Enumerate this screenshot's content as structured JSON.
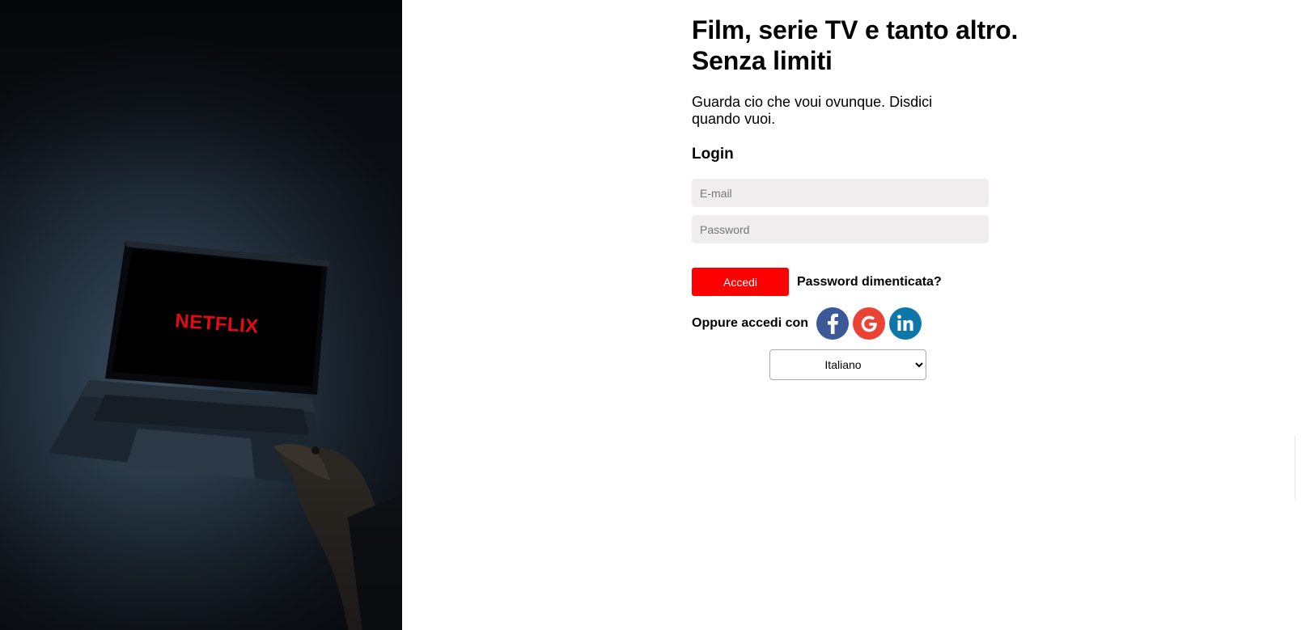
{
  "hero": {
    "brand_text": "NETFLIX"
  },
  "main": {
    "headline_line1": "Film, serie TV e tanto altro.",
    "headline_line2": "Senza limiti",
    "subtitle": "Guarda cio che voui ovunque. Disdici quando vuoi.",
    "login_heading": "Login",
    "email_placeholder": "E-mail",
    "password_placeholder": "Password",
    "login_button": "Accedi",
    "forgot_password": "Password dimenticata?",
    "social_label": "Oppure accedi con",
    "social_icons": [
      "facebook-icon",
      "google-icon",
      "linkedin-icon"
    ],
    "language_selected": "Italiano"
  },
  "colors": {
    "accent": "#ff0000",
    "facebook": "#3b5998",
    "google": "#ea4335",
    "linkedin": "#0e76a8",
    "input_bg": "#efeded"
  }
}
